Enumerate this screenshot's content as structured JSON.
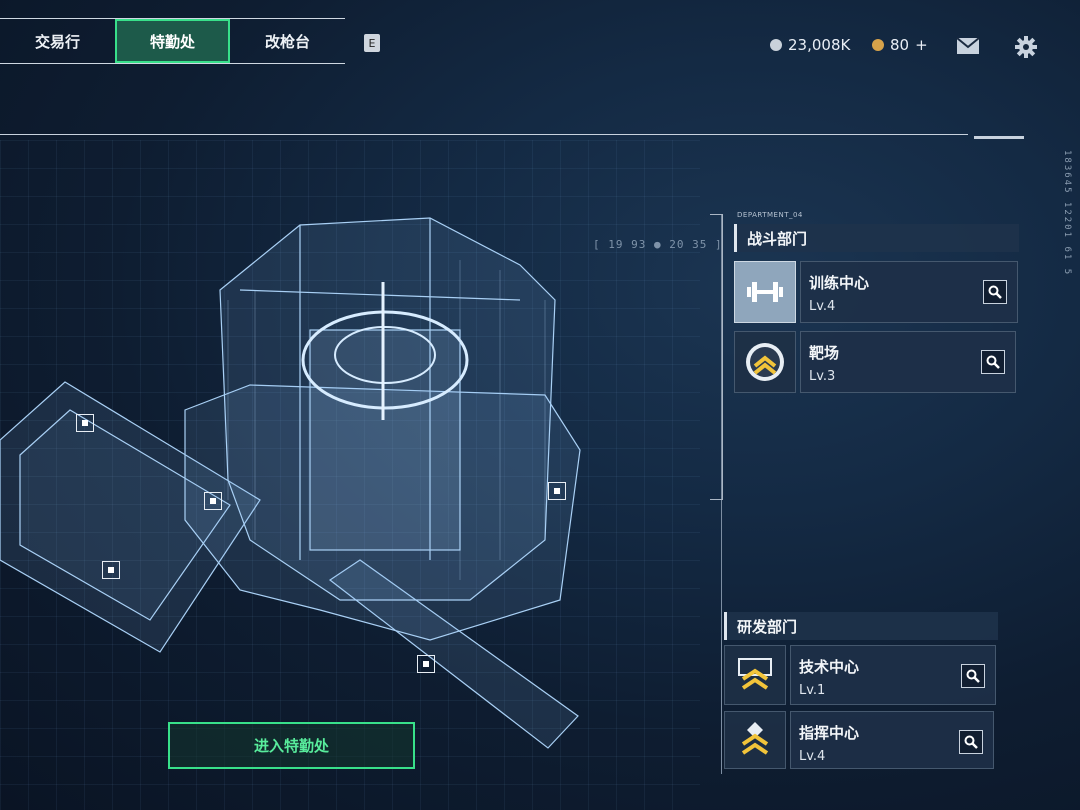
{
  "tabs": [
    {
      "label": "交易行",
      "active": false
    },
    {
      "label": "特勤处",
      "active": true
    },
    {
      "label": "改枪台",
      "active": false
    }
  ],
  "shortcut_key": "E",
  "currency": {
    "silver": {
      "amount": "23,008K",
      "color": "#c9d1da"
    },
    "gold": {
      "amount": "80",
      "plus": "+",
      "color": "#d6a24a"
    }
  },
  "header_icons": [
    "mail-icon",
    "gear-icon"
  ],
  "coords_label": "[ 19 93 ● 20 35 ]",
  "side_numbers": "183645  12201  61 5",
  "department_tag": "DEPARTMENT_04",
  "combat": {
    "title": "战斗部门",
    "facilities": [
      {
        "name": "训练中心",
        "level": "Lv.4",
        "icon": "dumbbell-icon"
      },
      {
        "name": "靶场",
        "level": "Lv.3",
        "icon": "target-chevron-icon"
      }
    ]
  },
  "rnd": {
    "title": "研发部门",
    "facilities": [
      {
        "name": "技术中心",
        "level": "Lv.1",
        "icon": "tech-chevron-icon"
      },
      {
        "name": "指挥中心",
        "level": "Lv.4",
        "icon": "command-chevron-icon"
      }
    ]
  },
  "enter_button": "进入特勤处",
  "colors": {
    "accent_green": "#38e08a",
    "panel": "#1e3048"
  }
}
